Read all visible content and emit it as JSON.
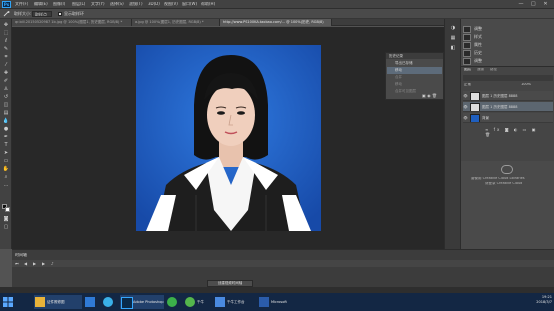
{
  "app": {
    "name": "Ps",
    "window_controls": [
      "—",
      "□",
      "✕"
    ]
  },
  "menu": [
    "文件(F)",
    "编辑(E)",
    "图像(I)",
    "图层(L)",
    "文字(Y)",
    "选择(S)",
    "滤镜(T)",
    "3D(D)",
    "视图(V)",
    "窗口(W)",
    "帮助(H)"
  ],
  "options_bar": {
    "sample_label": "取样大小:",
    "sample_value": "取样点",
    "show_ring": "显示取样环"
  },
  "tabs": [
    {
      "label": "qr.bill.20150520987 1b.jpg @ 100%(图层1, 历史图层, RGB/8) *",
      "active": false
    },
    {
      "label": "a.jpg @ 100%(图层1, 历史图层, RGB/8) *",
      "active": false
    },
    {
      "label": "http://www.PS100KA.taobao.com/... @ 100%(历史, RGB/8)",
      "active": true
    }
  ],
  "history": {
    "title": "历史记录",
    "items": [
      {
        "label": "导出已存储",
        "state": "normal"
      },
      {
        "label": "移动",
        "state": "selected"
      },
      {
        "label": "合并",
        "state": "dim"
      },
      {
        "label": "移动",
        "state": "dim"
      },
      {
        "label": "合并可见图层",
        "state": "dim"
      }
    ]
  },
  "dock": {
    "buttons": [
      {
        "label": "调整",
        "icon": "color-icon"
      },
      {
        "label": "样式",
        "icon": "swatches-icon"
      },
      {
        "label": "属性",
        "icon": "properties-icon"
      },
      {
        "label": "历史",
        "icon": "history-icon"
      },
      {
        "label": "调整",
        "icon": "adjust-icon"
      }
    ]
  },
  "layers": {
    "tabs": [
      "图层",
      "通道",
      "路径"
    ],
    "mode": "正常",
    "opacity": "100%",
    "items": [
      {
        "name": "图层 1 历史图层 8888",
        "selected": false
      },
      {
        "name": "图层 1 历史图层 8888",
        "selected": true
      },
      {
        "name": "背景",
        "selected": false
      }
    ]
  },
  "creative_cloud": {
    "line1": "要使用 Creative Cloud Libraries",
    "line2": "请登录 Creative Cloud"
  },
  "timeline": {
    "title": "时间轴",
    "create_button": "创建视频时间轴"
  },
  "taskbar": {
    "items": [
      {
        "label": "证件照修图",
        "icon": "folder-icon",
        "color": "#e8b33a"
      },
      {
        "label": "",
        "icon": "teamviewer-icon",
        "color": "#2f7ad6"
      },
      {
        "label": "",
        "icon": "qq-icon",
        "color": "#3ab0e8"
      },
      {
        "label": "Adobe Photoshop",
        "icon": "photoshop-icon",
        "color": "#0a2a4a"
      },
      {
        "label": "",
        "icon": "wechat-icon",
        "color": "#3cb04a"
      },
      {
        "label": "千牛",
        "icon": "qianniu-icon",
        "color": "#55b64c"
      },
      {
        "label": "千牛工作台",
        "icon": "qianniu-wb-icon",
        "color": "#4a8ae0"
      },
      {
        "label": "Microsoft",
        "icon": "word-icon",
        "color": "#2b5caa"
      }
    ],
    "time": "19:21",
    "date": "2018/3/7"
  }
}
